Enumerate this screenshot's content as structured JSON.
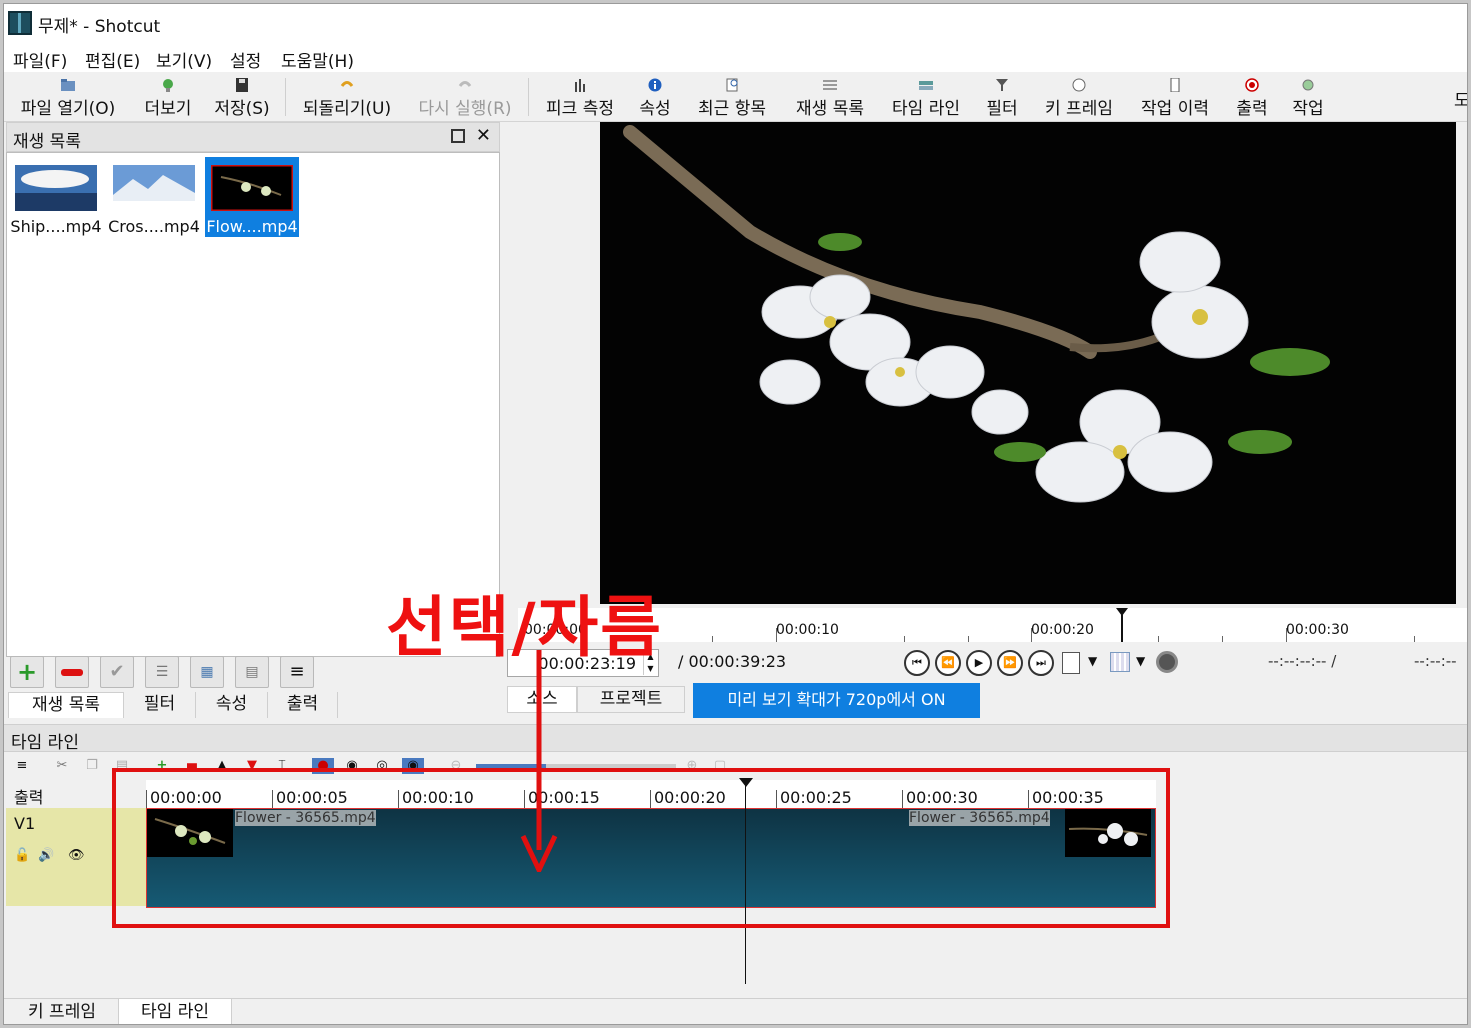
{
  "window": {
    "title": "무제* - Shotcut"
  },
  "menu": [
    "파일(F)",
    "편집(E)",
    "보기(V)",
    "설정",
    "도움말(H)"
  ],
  "toolbar": {
    "open": "파일 열기(O)",
    "more": "더보기",
    "save": "저장(S)",
    "undo": "되돌리기(U)",
    "redo": "다시 실행(R)",
    "peak": "피크 측정",
    "properties": "속성",
    "recent": "최근 항목",
    "playlist": "재생 목록",
    "timeline": "타임 라인",
    "filters": "필터",
    "keyframes": "키 프레임",
    "history": "작업 이력",
    "export": "출력",
    "jobs": "작업",
    "overflow": "도"
  },
  "playlist": {
    "title": "재생 목록",
    "items": [
      {
        "name": "Ship....mp4"
      },
      {
        "name": "Cros....mp4"
      },
      {
        "name": "Flow....mp4"
      }
    ],
    "tabs": [
      "재생 목록",
      "필터",
      "속성",
      "출력"
    ]
  },
  "player": {
    "ruler": [
      "00:00:00",
      "00:00:10",
      "00:00:20",
      "00:00:30"
    ],
    "position": "00:00:23:19",
    "duration": "/ 00:00:39:23",
    "in_point": "--:--:--:-- /",
    "out_point": "--:--:--",
    "tabs": [
      "소스",
      "프로젝트"
    ],
    "preview_badge": "미리 보기 확대가 720p에서 ON"
  },
  "timeline": {
    "title": "타임 라인",
    "output_label": "출력",
    "track_label": "V1",
    "ruler": [
      "00:00:00",
      "00:00:05",
      "00:00:10",
      "00:00:15",
      "00:00:20",
      "00:00:25",
      "00:00:30",
      "00:00:35"
    ],
    "clip_name": "Flower - 36565.mp4",
    "clip_name_end": "Flower - 36565.mp4"
  },
  "bottom_tabs": [
    "키 프레임",
    "타임 라인"
  ],
  "annotation": {
    "text": "선택/자름",
    "color": "#e01010"
  },
  "colors": {
    "accent": "#0f7fe0",
    "clip": "#165a74",
    "track_header": "#e6e6a8"
  }
}
